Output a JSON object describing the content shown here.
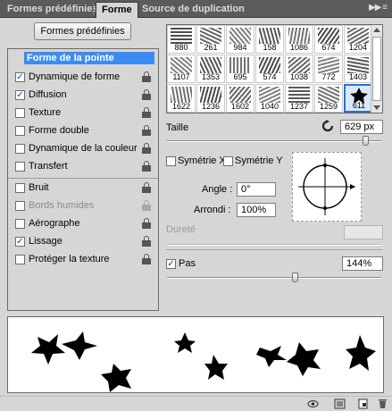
{
  "tabs": [
    {
      "label": "Formes prédéfinies",
      "active": false
    },
    {
      "label": "Forme",
      "active": true
    },
    {
      "label": "Source de duplication",
      "active": false
    }
  ],
  "menu_icon": "double-chevron-right",
  "presets_button": "Formes prédéfinies",
  "sections": [
    {
      "label": "Forme de la pointe",
      "selected": true,
      "checkbox": false
    },
    {
      "label": "Dynamique de forme",
      "checked": true,
      "lock": true
    },
    {
      "label": "Diffusion",
      "checked": true,
      "lock": true
    },
    {
      "label": "Texture",
      "checked": false,
      "lock": true
    },
    {
      "label": "Forme double",
      "checked": false,
      "lock": true
    },
    {
      "label": "Dynamique de la couleur",
      "checked": false,
      "lock": true
    },
    {
      "label": "Transfert",
      "checked": false,
      "lock": true
    },
    {
      "label": "Bruit",
      "checked": false,
      "lock": true
    },
    {
      "label": "Bords humides",
      "checked": false,
      "lock": true,
      "disabled": true
    },
    {
      "label": "Aérographe",
      "checked": false,
      "lock": true
    },
    {
      "label": "Lissage",
      "checked": true,
      "lock": true
    },
    {
      "label": "Protéger la texture",
      "checked": false,
      "lock": true
    }
  ],
  "brushes": [
    [
      "880",
      "261",
      "984",
      "158",
      "1086",
      "674",
      "1204"
    ],
    [
      "1107",
      "1353",
      "695",
      "574",
      "1038",
      "772",
      "1403"
    ],
    [
      "1622",
      "1236",
      "1602",
      "1040",
      "1237",
      "1259",
      "611"
    ]
  ],
  "selected_brush": "611",
  "size": {
    "label": "Taille",
    "value": "629 px",
    "level": 0.93
  },
  "flip_x": {
    "label": "Symétrie X",
    "checked": false
  },
  "flip_y": {
    "label": "Symétrie Y",
    "checked": false
  },
  "angle": {
    "label": "Angle :",
    "value": "0°"
  },
  "roundness": {
    "label": "Arrondi :",
    "value": "100%"
  },
  "hardness": {
    "label": "Dureté",
    "value": ""
  },
  "spacing": {
    "label": "Pas",
    "checked": true,
    "value": "144%",
    "level": 0.6
  }
}
